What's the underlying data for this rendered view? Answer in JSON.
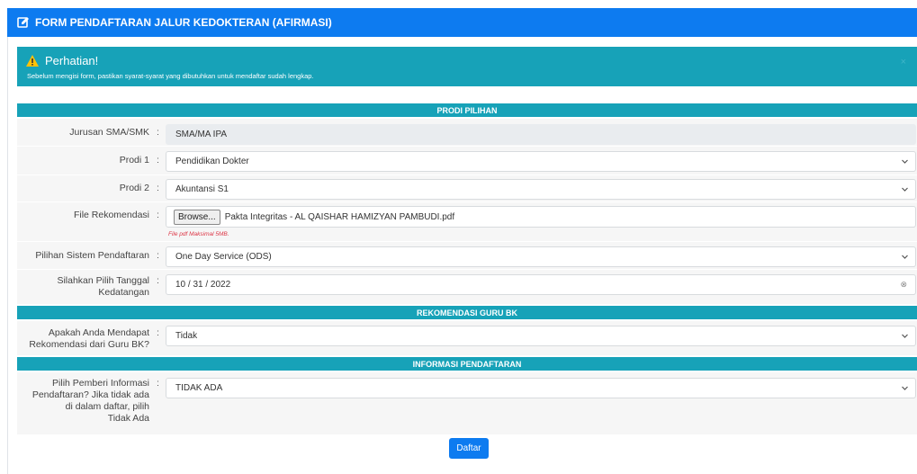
{
  "header": {
    "title": "FORM PENDAFTARAN JALUR KEDOKTERAN (AFIRMASI)"
  },
  "alert": {
    "title": "Perhatian!",
    "text": "Sebelum mengisi form, pastikan syarat-syarat yang dibutuhkan untuk mendaftar sudah lengkap.",
    "close": "×"
  },
  "sections": {
    "prodi": "PRODI PILIHAN",
    "rekomendasi": "REKOMENDASI GURU BK",
    "informasi": "INFORMASI PENDAFTARAN"
  },
  "colon": ":",
  "fields": {
    "jurusan": {
      "label": "Jurusan SMA/SMK",
      "value": "SMA/MA IPA"
    },
    "prodi1": {
      "label": "Prodi 1",
      "value": "Pendidikan Dokter"
    },
    "prodi2": {
      "label": "Prodi 2",
      "value": "Akuntansi S1"
    },
    "file": {
      "label": "File Rekomendasi",
      "button": "Browse...",
      "filename": "Pakta Integritas - AL QAISHAR HAMIZYAN PAMBUDI.pdf",
      "hint": "File pdf Maksimal 5MB."
    },
    "sistem": {
      "label": "Pilihan Sistem Pendaftaran",
      "value": "One Day Service (ODS)"
    },
    "tanggal": {
      "label_line1": "Silahkan Pilih Tanggal",
      "label_line2": "Kedatangan",
      "value": "10 / 31 / 2022",
      "clear": "⊗"
    },
    "rekomendasi": {
      "label_line1": "Apakah Anda Mendapat",
      "label_line2": "Rekomendasi dari Guru BK?",
      "value": "Tidak"
    },
    "informasi": {
      "label_line1": "Pilih Pemberi Informasi",
      "label_line2": "Pendaftaran? Jika tidak ada",
      "label_line3": "di dalam daftar, pilih",
      "label_line4": "Tidak Ada",
      "value": "TIDAK ADA"
    }
  },
  "submit": {
    "label": "Daftar"
  },
  "colors": {
    "primary": "#0d7bf0",
    "info": "#17a2b8",
    "danger": "#dc3545"
  }
}
